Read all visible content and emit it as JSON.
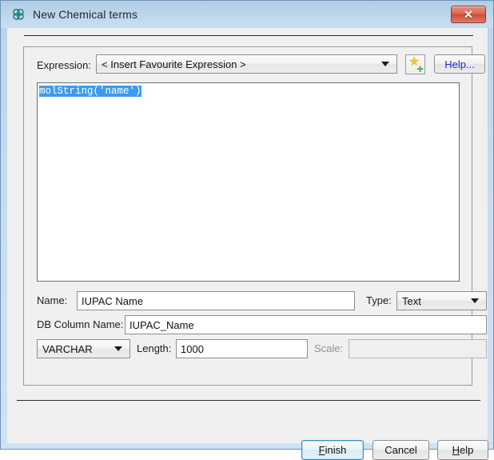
{
  "window": {
    "title": "New Chemical terms",
    "icon": "molecule-icon",
    "close_label": "✕",
    "accent_blue": "#3c9bf0",
    "titlebar_color": "#bcd6ea",
    "close_color": "#cf4b37"
  },
  "expression_row": {
    "label": "Expression:",
    "combo_value": "< Insert Favourite Expression >",
    "add_favourite_icon": "star-plus-icon",
    "help_label": "Help..."
  },
  "editor": {
    "text": "molString('name')",
    "selected": true
  },
  "name_row": {
    "label": "Name:",
    "value": "IUPAC Name",
    "type_label": "Type:",
    "type_value": "Text"
  },
  "db_row": {
    "label": "DB Column Name:",
    "value": "IUPAC_Name"
  },
  "sql_row": {
    "sql_type": "VARCHAR",
    "length_label": "Length:",
    "length_value": "1000",
    "scale_label": "Scale:",
    "scale_value": ""
  },
  "buttons": {
    "finish_mnemonic": "F",
    "finish_rest": "inish",
    "cancel": "Cancel",
    "help_mnemonic": "H",
    "help_rest": "elp"
  }
}
